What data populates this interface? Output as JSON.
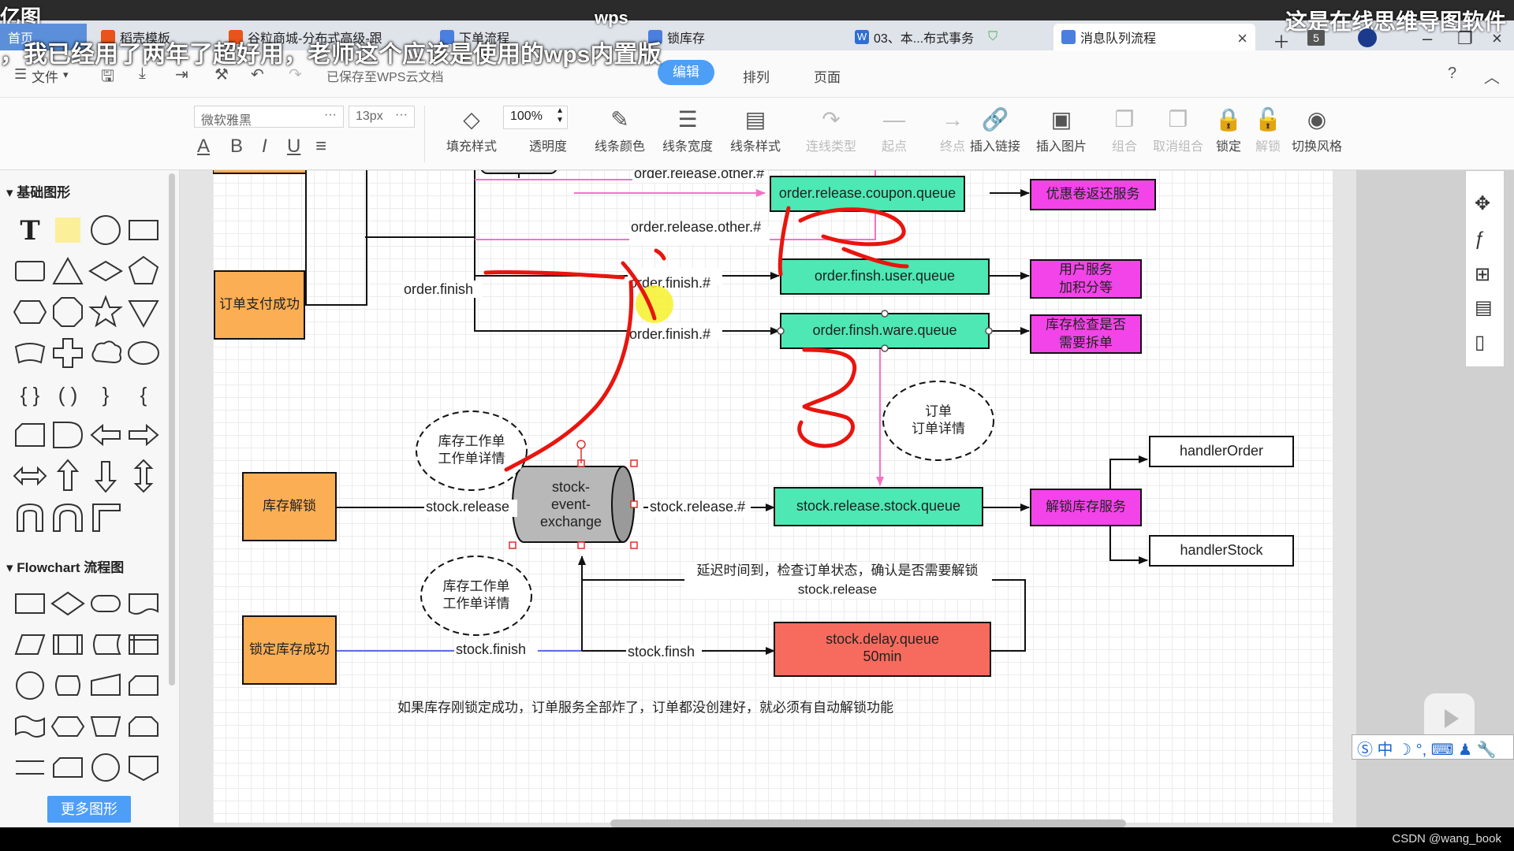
{
  "watermarks": {
    "left": "亿图",
    "right": "这是在线思维导图软件",
    "center": "wps",
    "subtitle": "，我已经用了两年了超好用，老师这个应该是使用的wps内置版",
    "credit": "CSDN @wang_book"
  },
  "tabs": [
    {
      "label": "首页",
      "color": "#5b8fd9"
    },
    {
      "label": "稻壳模板",
      "color": "#e8541a"
    },
    {
      "label": "谷粒商城-分布式高级-跟",
      "color": "#e8541a"
    },
    {
      "label": "下单流程",
      "color": "#4a7fe0"
    },
    {
      "label": "锁库存",
      "color": "#4a7fe0"
    },
    {
      "label": "03、本...布式事务",
      "color": "#2f6fd4"
    },
    {
      "label": "消息队列流程",
      "color": "#4a7fe0"
    }
  ],
  "tab_badge": "5",
  "menubar": {
    "file": "文件",
    "saved_status": "已保存至WPS云文档",
    "edit": "编辑",
    "arrange": "排列",
    "page": "页面"
  },
  "toolbar": {
    "font_family": "微软雅黑",
    "font_size": "13px",
    "opacity": "100%",
    "format_glyphs": [
      "A",
      "B",
      "I",
      "U",
      "≡"
    ],
    "buttons": [
      {
        "label": "填充样式",
        "icon": "fill-icon",
        "glyph": "◇",
        "enabled": true
      },
      {
        "label": "透明度",
        "icon": "opacity-icon",
        "glyph": "",
        "enabled": true
      },
      {
        "label": "线条颜色",
        "icon": "pen-icon",
        "glyph": "✎",
        "enabled": true
      },
      {
        "label": "线条宽度",
        "icon": "line-width-icon",
        "glyph": "☰",
        "enabled": true
      },
      {
        "label": "线条样式",
        "icon": "line-style-icon",
        "glyph": "▤",
        "enabled": true
      },
      {
        "label": "连线类型",
        "icon": "connector-icon",
        "glyph": "↷",
        "enabled": false
      },
      {
        "label": "起点",
        "icon": "start-point-icon",
        "glyph": "—",
        "enabled": false
      },
      {
        "label": "终点",
        "icon": "end-point-icon",
        "glyph": "→",
        "enabled": false
      },
      {
        "label": "插入链接",
        "icon": "link-icon",
        "glyph": "🔗",
        "enabled": true
      },
      {
        "label": "插入图片",
        "icon": "image-icon",
        "glyph": "▣",
        "enabled": true
      },
      {
        "label": "组合",
        "icon": "group-icon",
        "glyph": "❐",
        "enabled": false
      },
      {
        "label": "取消组合",
        "icon": "ungroup-icon",
        "glyph": "❐",
        "enabled": false
      },
      {
        "label": "锁定",
        "icon": "lock-icon",
        "glyph": "🔒",
        "enabled": true
      },
      {
        "label": "解锁",
        "icon": "unlock-icon",
        "glyph": "🔓",
        "enabled": false
      },
      {
        "label": "切换风格",
        "icon": "style-switch-icon",
        "glyph": "◉",
        "enabled": true
      }
    ]
  },
  "left_panel": {
    "basic_title": "基础图形",
    "flowchart_title": "Flowchart 流程图",
    "more_button": "更多图形"
  },
  "diagram": {
    "colors": {
      "queue": "#4de8b4",
      "service": "#f244e8",
      "event": "#fbae54",
      "delay": "#f66b5e",
      "exchange": "#b8b8b8",
      "pink_line": "#f472c4",
      "blue_line": "#5b6ee8",
      "annotation": "#e8150e"
    },
    "events": {
      "order_paid": "订单支付成功",
      "stock_unlock": "库存解锁",
      "stock_locked": "锁定库存成功"
    },
    "queues": {
      "coupon": "order.release.coupon.queue",
      "user": "order.finsh.user.queue",
      "ware": "order.finsh.ware.queue",
      "stock_release": "stock.release.stock.queue",
      "delay_name": "stock.delay.queue",
      "delay_ttl": "50min"
    },
    "services": {
      "coupon": [
        "优惠卷返还服务"
      ],
      "user": [
        "用户服务",
        "加积分等"
      ],
      "ware": [
        "库存检查是否",
        "需要拆单"
      ],
      "unlock": "解锁库存服务"
    },
    "handlers": {
      "order": "handlerOrder",
      "stock": "handlerStock"
    },
    "exchange": [
      "stock-",
      "event-",
      "exchange"
    ],
    "notes": {
      "order_detail": [
        "订单",
        "订单详情"
      ],
      "stock_task_1": [
        "库存工作单",
        "工作单详情"
      ],
      "stock_task_2": [
        "库存工作单",
        "工作单详情"
      ]
    },
    "edge_labels": {
      "release_other_1": "order.release.other.#",
      "release_other_2": "order.release.other.#",
      "order_finish": "order.finish",
      "finish_1": "order.finish.#",
      "finish_2": "order.finish.#",
      "stock_release": "stock.release",
      "stock_release_rk": "stock.release.#",
      "stock_finish": "stock.finish",
      "stock_finsh": "stock.finsh",
      "delay_note_1": "延迟时间到，检查订单状态，确认是否需要解锁",
      "delay_note_2": "stock.release"
    },
    "footnote": "如果库存刚锁定成功，订单服务全部炸了，订单都没创建好，就必须有自动解锁功能"
  }
}
